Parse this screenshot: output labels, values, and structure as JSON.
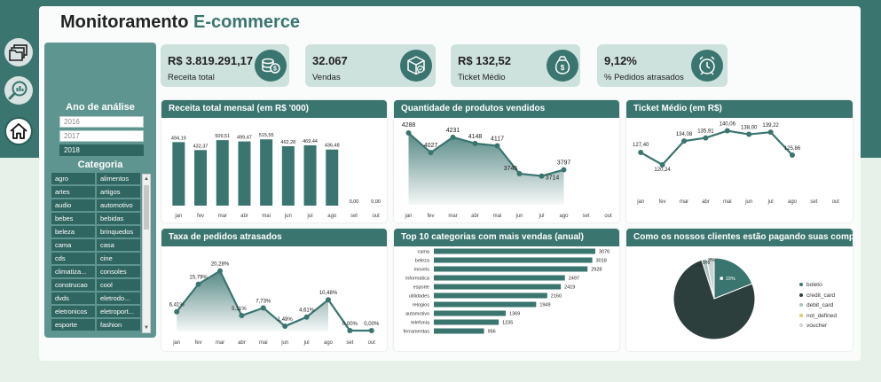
{
  "title": {
    "part1": "Monitoramento ",
    "part2": "E-commerce"
  },
  "nav": [
    {
      "name": "folders-icon"
    },
    {
      "name": "search-chart-icon"
    },
    {
      "name": "home-icon"
    }
  ],
  "filters": {
    "year_title": "Ano de análise",
    "years": [
      "2016",
      "2017",
      "2018"
    ],
    "selected_year": "2018",
    "category_title": "Categoria",
    "categories": [
      "agro",
      "alimentos",
      "artes",
      "artigos",
      "audio",
      "automotivo",
      "bebes",
      "bebidas",
      "beleza",
      "brinquedos",
      "cama",
      "casa",
      "cds",
      "cine",
      "climatiza...",
      "consoles",
      "construcao",
      "cool",
      "dvds",
      "eletrodo...",
      "eletronicos",
      "eletroport...",
      "esporte",
      "fashion"
    ]
  },
  "kpis": [
    {
      "value": "R$ 3.819.291,17",
      "label": "Receita total",
      "icon": "coins-icon"
    },
    {
      "value": "32.067",
      "label": "Vendas",
      "icon": "box-icon"
    },
    {
      "value": "R$ 132,52",
      "label": "Ticket Médio",
      "icon": "money-bag-icon"
    },
    {
      "value": "9,12%",
      "label": "% Pedidos atrasados",
      "icon": "clock-icon"
    }
  ],
  "colors": {
    "primary": "#3a756f",
    "dark": "#2f6661",
    "pie_credit": "#2d3f3d",
    "pie_boleto": "#3a756f",
    "pie_debit": "#a7c5c1",
    "pie_voucher": "#c9d3d1",
    "pie_notdef": "#e6c76d"
  },
  "charts": {
    "revenue": {
      "title": "Receita total mensal (em R$ '000)"
    },
    "quantity": {
      "title": "Quantidade de produtos vendidos"
    },
    "ticket": {
      "title": "Ticket Médio (em R$)"
    },
    "late": {
      "title": "Taxa de pedidos atrasados"
    },
    "top10": {
      "title": "Top 10 categorias com mais vendas (anual)"
    },
    "payment": {
      "title": "Como os nossos clientes estão pagando suas compras?"
    }
  },
  "chart_data": [
    {
      "type": "bar",
      "title": "Receita total mensal (em R$ '000)",
      "categories": [
        "jan",
        "fev",
        "mar",
        "abr",
        "mai",
        "jun",
        "jul",
        "ago",
        "set",
        "out"
      ],
      "values": [
        494.19,
        432.37,
        509.51,
        499.47,
        515.55,
        462.28,
        469.44,
        436.48,
        0.0,
        0.0
      ],
      "labels": [
        "494,19",
        "432,37",
        "509,51",
        "499,47",
        "515,55",
        "462,28",
        "469,44",
        "436,48",
        "0,00",
        "0,00"
      ]
    },
    {
      "type": "area",
      "title": "Quantidade de produtos vendidos",
      "categories": [
        "jan",
        "fev",
        "mar",
        "abr",
        "mai",
        "jun",
        "jul",
        "ago",
        "set",
        "out"
      ],
      "values": [
        4288,
        4027,
        4231,
        4148,
        4117,
        3745,
        3714,
        3797,
        null,
        null
      ],
      "labels": [
        "4288",
        "4027",
        "4231",
        "4148",
        "4117",
        "3745",
        "3714",
        "3797",
        "",
        ""
      ]
    },
    {
      "type": "line",
      "title": "Ticket Médio (em R$)",
      "categories": [
        "jan",
        "fev",
        "mar",
        "abr",
        "mai",
        "jun",
        "jul",
        "ago",
        "set",
        "out"
      ],
      "values": [
        127.4,
        120.24,
        134.08,
        135.91,
        140.06,
        138.0,
        139.22,
        125.86,
        null,
        null
      ],
      "labels": [
        "127,40",
        "120,24",
        "134,08",
        "135,91",
        "140,06",
        "138,00",
        "139,22",
        "125,86",
        "",
        ""
      ]
    },
    {
      "type": "area",
      "title": "Taxa de pedidos atrasados",
      "categories": [
        "jan",
        "fev",
        "mar",
        "abr",
        "mai",
        "jun",
        "jul",
        "ago",
        "set",
        "out"
      ],
      "values": [
        6.41,
        15.79,
        20.28,
        5.11,
        7.73,
        1.49,
        4.61,
        10.48,
        0.0,
        0.0
      ],
      "labels": [
        "6,41%",
        "15,79%",
        "20,28%",
        "5,11%",
        "7,73%",
        "1,49%",
        "4,61%",
        "10,48%",
        "0,00%",
        "0,00%"
      ]
    },
    {
      "type": "bar",
      "orientation": "horizontal",
      "title": "Top 10 categorias com mais vendas (anual)",
      "categories": [
        "cama",
        "beleza",
        "moveis",
        "informatica",
        "esporte",
        "utilidades",
        "relogios",
        "automotivo",
        "telefonia",
        "ferramentas"
      ],
      "values": [
        3076,
        3018,
        2928,
        2497,
        2419,
        2160,
        1949,
        1369,
        1235,
        956
      ]
    },
    {
      "type": "pie",
      "title": "Como os nossos clientes estão pagando suas compras?",
      "categories": [
        "boleto",
        "credit_card",
        "debit_card",
        "not_defined",
        "voucher"
      ],
      "values": [
        19,
        76,
        2,
        0,
        3
      ],
      "labels": [
        "19%",
        "",
        "2%",
        "0%",
        "3%"
      ]
    }
  ]
}
